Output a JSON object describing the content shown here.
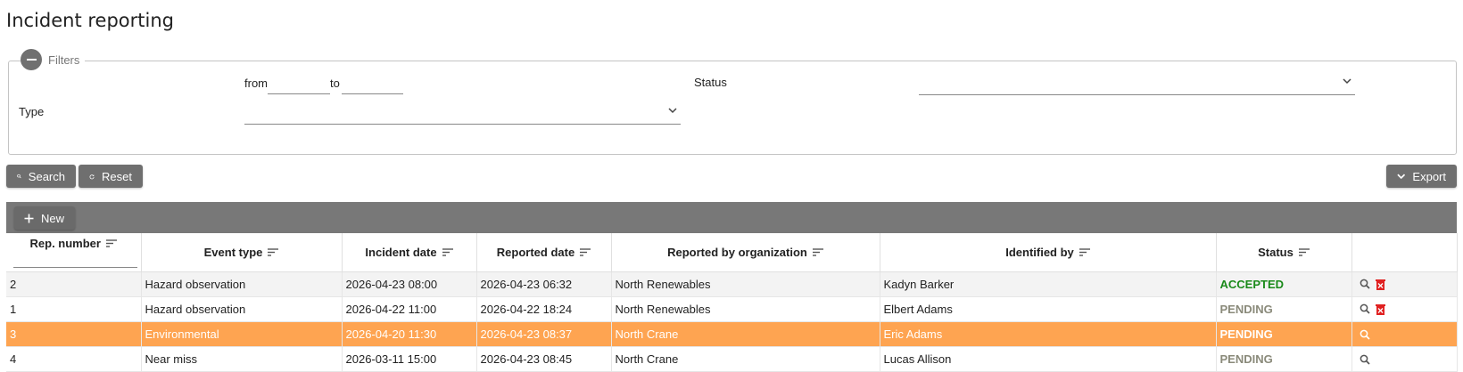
{
  "page": {
    "title": "Incident reporting"
  },
  "filters": {
    "legend": "Filters",
    "from_label": "from",
    "to_label": "to",
    "status_label": "Status",
    "type_label": "Type",
    "from_value": "",
    "to_value": "",
    "status_value": "",
    "type_value": ""
  },
  "actions": {
    "search_label": "Search",
    "reset_label": "Reset",
    "export_label": "Export",
    "new_label": "New"
  },
  "table": {
    "columns": [
      "Rep. number",
      "Event type",
      "Incident date",
      "Reported date",
      "Reported by organization",
      "Identified by",
      "Status"
    ],
    "rows": [
      {
        "rep": "2",
        "event": "Hazard observation",
        "incident_date": "2026-04-23 08:00",
        "reported_date": "2026-04-23 06:32",
        "org": "North Renewables",
        "identified_by": "Kadyn Barker",
        "status": "ACCEPTED",
        "can_delete": true,
        "selected": false
      },
      {
        "rep": "1",
        "event": "Hazard observation",
        "incident_date": "2026-04-22 11:00",
        "reported_date": "2026-04-22 18:24",
        "org": "North Renewables",
        "identified_by": "Elbert Adams",
        "status": "PENDING",
        "can_delete": true,
        "selected": false
      },
      {
        "rep": "3",
        "event": "Environmental",
        "incident_date": "2026-04-20 11:30",
        "reported_date": "2026-04-23 08:37",
        "org": "North Crane",
        "identified_by": "Eric Adams",
        "status": "PENDING",
        "can_delete": false,
        "selected": true
      },
      {
        "rep": "4",
        "event": "Near miss",
        "incident_date": "2026-03-11 15:00",
        "reported_date": "2026-04-23 08:45",
        "org": "North Crane",
        "identified_by": "Lucas Allison",
        "status": "PENDING",
        "can_delete": false,
        "selected": false
      }
    ]
  },
  "colors": {
    "accepted": "#1a8a1a",
    "pending": "#8a8a7a",
    "selected_row": "#fea451",
    "delete_icon": "#e02020",
    "toolbar": "#787878"
  },
  "icons": {
    "collapse": "minus-circle-icon",
    "search": "search-icon",
    "reset": "refresh-icon",
    "export": "chevron-down-icon",
    "new": "plus-icon",
    "sort": "sort-icon",
    "view": "magnifier-icon",
    "delete": "delete-icon"
  }
}
